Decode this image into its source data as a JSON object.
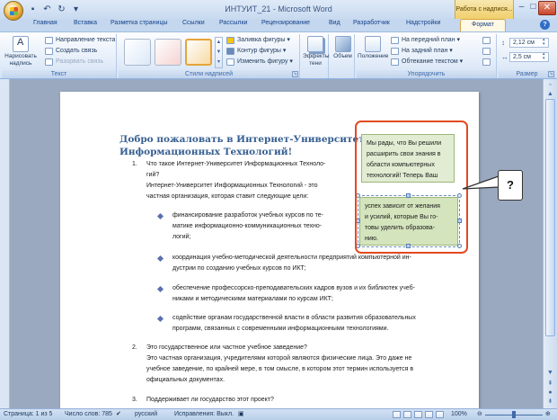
{
  "window": {
    "title": "ИНТУИТ_21 - Microsoft Word",
    "context_tab_group": "Работа с надпися...",
    "minimize_label": "–",
    "maximize_label": "□",
    "close_label": "✕"
  },
  "tabs": [
    {
      "label": "Главная"
    },
    {
      "label": "Вставка"
    },
    {
      "label": "Разметка страницы"
    },
    {
      "label": "Ссылки"
    },
    {
      "label": "Рассылки"
    },
    {
      "label": "Рецензирование"
    },
    {
      "label": "Вид"
    },
    {
      "label": "Разработчик"
    },
    {
      "label": "Надстройки"
    },
    {
      "label": "Формат",
      "active": true
    }
  ],
  "ribbon": {
    "text_group": {
      "label": "Текст",
      "draw_textbox": "Нарисовать надпись",
      "text_direction": "Направление текста",
      "create_link": "Создать связь",
      "break_link": "Разорвать связь"
    },
    "styles_group": {
      "label": "Стили надписей",
      "fill": "Заливка фигуры",
      "outline": "Контур фигуры",
      "change_shape": "Изменить фигуру",
      "swatches": [
        "#dce9f7",
        "#f4d3d1",
        "#f7d9a3"
      ]
    },
    "shadow_group": {
      "label": "Эффекты тени",
      "effects": "Эффекты тени"
    },
    "volume_group": {
      "label": "Объем",
      "volume": "Объем"
    },
    "arrange_group": {
      "label": "Упорядочить",
      "position": "Положение",
      "bring_front": "На передний план",
      "send_back": "На задний план",
      "text_wrap": "Обтекание текстом"
    },
    "size_group": {
      "label": "Размер",
      "height": "2,12 см",
      "width": "2,5 см"
    }
  },
  "document": {
    "heading": "Добро пожаловать в Интернет-Университет Информационных Технологий!",
    "items": [
      {
        "num": "1.",
        "lines": [
          "Что такое Интернет-Университет Информационных Техноло-",
          "гий?",
          "Интернет-Университет Информационных Технологий - это",
          "частная организация, которая ставит следующие цели:"
        ]
      },
      {
        "num": "2.",
        "lines": [
          "Это государственное или частное учебное заведение?",
          "Это частная организация, учредителями которой являются физические лица. Это даже не",
          "учебное заведение, по крайней мере, в том смысле, в котором этот термин используется в",
          "официальных документах."
        ]
      },
      {
        "num": "3.",
        "lines": [
          "Поддерживает ли государство этот проект?"
        ]
      }
    ],
    "bullets": [
      [
        "финансирование разработок учебных курсов по те-",
        "матике информационно-коммуникационных техно-",
        "логий;"
      ],
      [
        "координация учебно-методической деятельности предприятий компьютерной ин-",
        "дустрии по созданию учебных курсов по ИКТ;"
      ],
      [
        "обеспечение профессорско-преподавательских кадров вузов и их библиотек учеб-",
        "никами и методическими материалами по курсам ИКТ;"
      ],
      [
        "содействие органам государственной власти в области развития образовательных",
        "программ, связанных с современными информационными технологиями."
      ]
    ],
    "textbox1": [
      "Мы рады, что Вы решили",
      "расширить свои знания в",
      "области компьютерных",
      "технологий! Теперь Ваш"
    ],
    "textbox2": [
      "успех зависит от желания",
      "и усилий, которые Вы го-",
      "товы уделить образова-",
      "нию."
    ],
    "callout": "?"
  },
  "statusbar": {
    "page": "Страница: 1 из 5",
    "words": "Число слов: 785",
    "language": "русский",
    "track_changes": "Исправления: Выкл.",
    "zoom": "100%",
    "zoom_level": 1.0
  },
  "colors": {
    "accent_frame": "#e34a21",
    "heading": "#365f91",
    "textbox_fill": "#e1ecd2"
  }
}
